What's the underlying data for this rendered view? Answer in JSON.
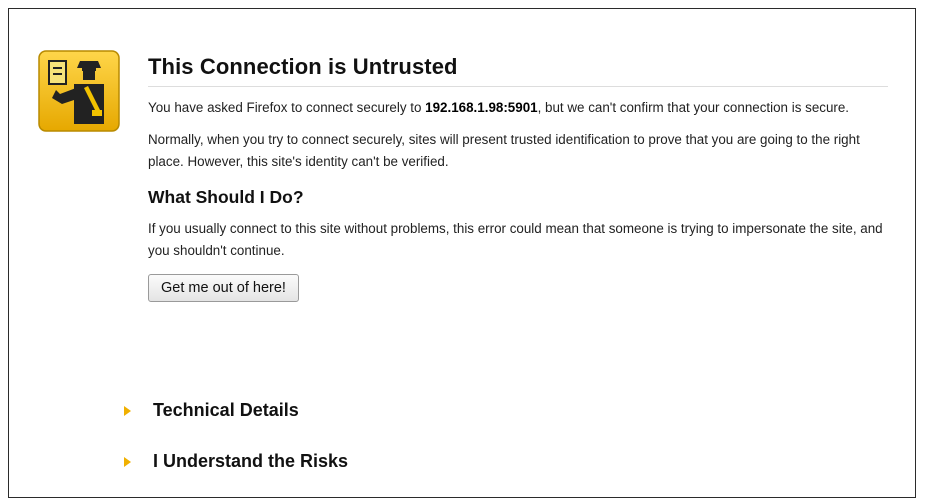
{
  "page": {
    "title": "This Connection is Untrusted",
    "intro_prefix": "You have asked Firefox to connect securely to ",
    "intro_host": "192.168.1.98:5901",
    "intro_suffix": ", but we can't confirm that your connection is secure.",
    "normally_text": "Normally, when you try to connect securely, sites will present trusted identification to prove that you are going to the right place. However, this site's identity can't be verified.",
    "what_heading": "What Should I Do?",
    "advice_text": "If you usually connect to this site without problems, this error could mean that someone is trying to impersonate the site, and you shouldn't continue.",
    "escape_button": "Get me out of here!"
  },
  "expanders": {
    "technical_details": "Technical Details",
    "understand_risks": "I Understand the Risks"
  },
  "icon": {
    "name": "untrusted-connection-guard-icon",
    "color": "#f2c200"
  },
  "colors": {
    "arrow": "#f0b000"
  }
}
